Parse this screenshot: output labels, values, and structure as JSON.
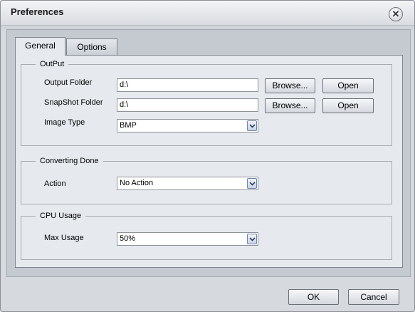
{
  "window": {
    "title": "Preferences",
    "close_icon": "close-icon"
  },
  "tabs": [
    {
      "label": "General",
      "active": true
    },
    {
      "label": "Options",
      "active": false
    }
  ],
  "output": {
    "legend": "OutPut",
    "output_folder_label": "Output Folder",
    "output_folder_value": "d:\\",
    "snapshot_folder_label": "SnapShot Folder",
    "snapshot_folder_value": "d:\\",
    "image_type_label": "Image Type",
    "image_type_value": "BMP",
    "browse_label": "Browse...",
    "open_label": "Open"
  },
  "converting": {
    "legend": "Converting Done",
    "action_label": "Action",
    "action_value": "No Action"
  },
  "cpu": {
    "legend": "CPU Usage",
    "max_usage_label": "Max Usage",
    "max_usage_value": "50%"
  },
  "footer": {
    "ok_label": "OK",
    "cancel_label": "Cancel"
  },
  "colors": {
    "panel": "#e6e9ee",
    "frame": "#c5cad1",
    "combo_arrow_border": "#6c85ad"
  }
}
